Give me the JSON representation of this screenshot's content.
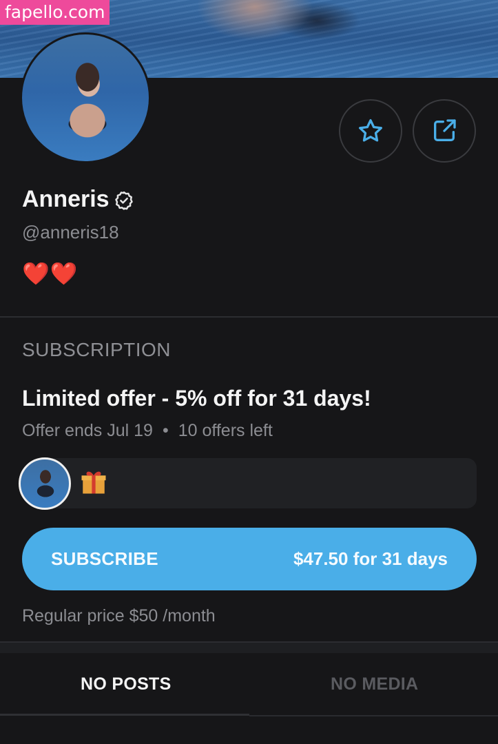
{
  "watermark": "fapello.com",
  "profile": {
    "name": "Anneris",
    "handle": "@anneris18",
    "bio": "❤️❤️"
  },
  "actions": {
    "favorite_icon": "star-icon",
    "share_icon": "share-icon"
  },
  "subscription": {
    "heading": "SUBSCRIPTION",
    "offer_title": "Limited offer - 5% off for 31 days!",
    "offer_ends": "Offer ends Jul 19",
    "offer_separator": "•",
    "offers_left": "10 offers left",
    "gift_icon": "🎁",
    "button_label": "SUBSCRIBE",
    "button_price": "$47.50 for 31 days",
    "regular_price": "Regular price $50 /month"
  },
  "tabs": [
    {
      "label": "NO POSTS",
      "active": true
    },
    {
      "label": "NO MEDIA",
      "active": false
    }
  ],
  "colors": {
    "background": "#161618",
    "accent": "#4aaee8",
    "muted_text": "#8c8d92",
    "watermark": "#ee4a9b"
  }
}
